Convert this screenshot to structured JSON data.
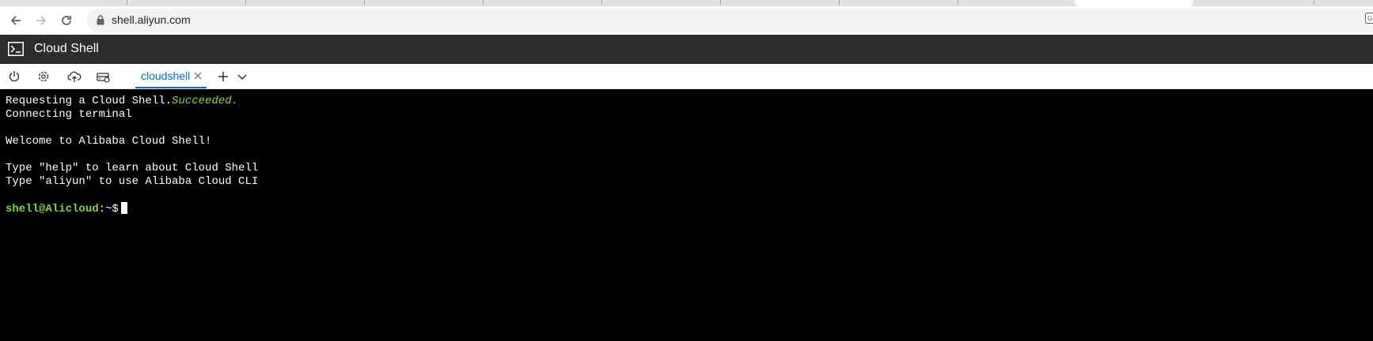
{
  "browser": {
    "url": "shell.aliyun.com",
    "back_icon": "back-arrow-icon",
    "forward_icon": "forward-arrow-icon",
    "reload_icon": "reload-icon",
    "lock_icon": "lock-icon",
    "translate_icon": "translate-icon"
  },
  "header": {
    "title": "Cloud Shell",
    "icon": "terminal-icon"
  },
  "toolbar": {
    "icons": [
      "power-icon",
      "gear-icon",
      "cloud-upload-icon",
      "storage-icon"
    ],
    "tab_label": "cloudshell",
    "add_icon": "plus-icon",
    "dropdown_icon": "chevron-down-icon",
    "accent": "#0070cc"
  },
  "terminal": {
    "line1_prefix": "Requesting a Cloud Shell.",
    "line1_status": "Succeeded.",
    "line2": "Connecting terminal",
    "line3": "Welcome to Alibaba Cloud Shell!",
    "line4": "Type \"help\" to learn about Cloud Shell",
    "line5": "Type \"aliyun\" to use Alibaba Cloud CLI",
    "prompt_user": "shell@Alicloud",
    "prompt_path": ":~$",
    "prompt_color": "#86d144"
  }
}
